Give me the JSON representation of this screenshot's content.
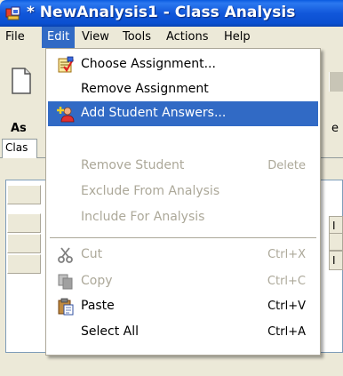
{
  "window": {
    "title": "* NewAnalysis1 - Class Analysis",
    "titlebar_color": "#1157da"
  },
  "menubar": {
    "items": [
      {
        "label": "File",
        "active": false
      },
      {
        "label": "Edit",
        "active": true
      },
      {
        "label": "View",
        "active": false
      },
      {
        "label": "Tools",
        "active": false
      },
      {
        "label": "Actions",
        "active": false
      },
      {
        "label": "Help",
        "active": false
      }
    ]
  },
  "background": {
    "section_label_fragment": "As",
    "right_label_fragment": "e",
    "tab_label_fragment": "Clas",
    "right_cell_1": "I",
    "right_cell_2": "I"
  },
  "edit_menu": {
    "highlight_color": "#316ac5",
    "items": [
      {
        "label": "Choose Assignment...",
        "shortcut": "",
        "icon": "choose-assignment-icon",
        "enabled": true,
        "highlighted": false
      },
      {
        "label": "Remove Assignment",
        "shortcut": "",
        "icon": "",
        "enabled": true,
        "highlighted": false
      },
      {
        "label": "Add Student Answers...",
        "shortcut": "",
        "icon": "add-student-icon",
        "enabled": true,
        "highlighted": true
      },
      {
        "label": "Remove Student",
        "shortcut": "Delete",
        "icon": "",
        "enabled": false,
        "highlighted": false
      },
      {
        "label": "Exclude From Analysis",
        "shortcut": "",
        "icon": "",
        "enabled": false,
        "highlighted": false
      },
      {
        "label": "Include For Analysis",
        "shortcut": "",
        "icon": "",
        "enabled": false,
        "highlighted": false
      },
      {
        "label": "Cut",
        "shortcut": "Ctrl+X",
        "icon": "scissors-icon",
        "enabled": false,
        "highlighted": false
      },
      {
        "label": "Copy",
        "shortcut": "Ctrl+C",
        "icon": "copy-icon",
        "enabled": false,
        "highlighted": false
      },
      {
        "label": "Paste",
        "shortcut": "Ctrl+V",
        "icon": "clipboard-paste-icon",
        "enabled": true,
        "highlighted": false
      },
      {
        "label": "Select All",
        "shortcut": "Ctrl+A",
        "icon": "",
        "enabled": true,
        "highlighted": false
      }
    ]
  }
}
